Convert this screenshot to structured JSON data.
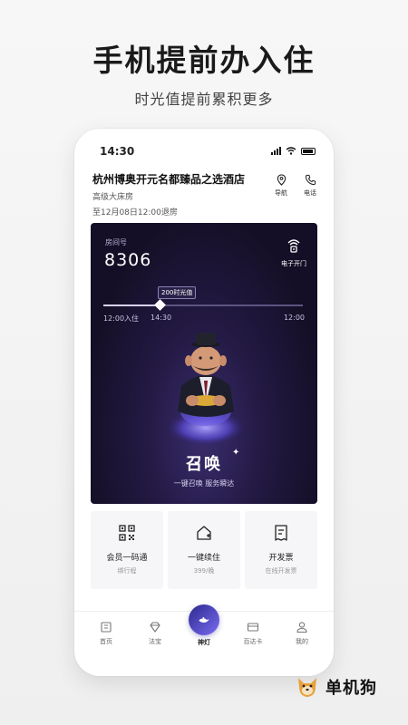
{
  "promo": {
    "title": "手机提前办入住",
    "subtitle": "时光值提前累积更多"
  },
  "status_bar": {
    "time": "14:30"
  },
  "hotel": {
    "name": "杭州博奥开元名都臻品之选酒店",
    "room_type": "高级大床房",
    "checkout": "至12月08日12:00退房",
    "nav_label": "导航",
    "phone_label": "电话"
  },
  "room_card": {
    "room_label": "房间号",
    "room_number": "8306",
    "door_label": "电子开门",
    "timeline": {
      "badge": "200时光值",
      "start": "12:00入住",
      "current": "14:30",
      "end": "12:00"
    },
    "summon_title": "召唤",
    "summon_subtitle": "一键召唤 服务瞬达"
  },
  "services": [
    {
      "title": "会员一码通",
      "subtitle": "绑行程",
      "icon": "qr-code-icon"
    },
    {
      "title": "一键续住",
      "subtitle": "399/晚",
      "icon": "home-plus-icon"
    },
    {
      "title": "开发票",
      "subtitle": "在线开发票",
      "icon": "invoice-icon"
    }
  ],
  "tabbar": {
    "items": [
      {
        "label": "首页",
        "icon": "home-icon"
      },
      {
        "label": "法宝",
        "icon": "gem-icon"
      },
      {
        "label": "神灯",
        "icon": "lamp-icon"
      },
      {
        "label": "百达卡",
        "icon": "card-icon"
      },
      {
        "label": "我的",
        "icon": "user-icon"
      }
    ]
  },
  "brand": {
    "text": "单机狗"
  },
  "colors": {
    "card_dark": "#140f26",
    "card_purple": "#3a2d6d",
    "accent_purple": "#7b6bf0"
  }
}
